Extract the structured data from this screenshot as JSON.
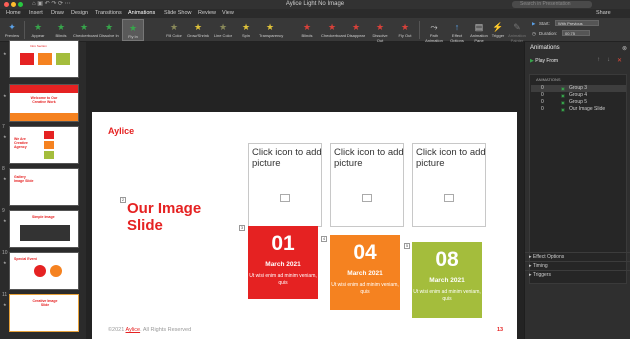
{
  "window": {
    "title": "Aylice Light No Image",
    "search_placeholder": "Search in Presentation"
  },
  "colors": {
    "close": "#fe5f57",
    "minimize": "#febc2e",
    "maximize": "#28c840",
    "accent": "#e52222"
  },
  "tabs": [
    "Home",
    "Insert",
    "Draw",
    "Design",
    "Transitions",
    "Animations",
    "Slide Show",
    "Review",
    "View"
  ],
  "share_label": "Share",
  "ribbon": {
    "preview": "Preview",
    "effects": [
      {
        "label": "Appear",
        "icon": "star-icon",
        "color": "#37a64b"
      },
      {
        "label": "Blinds",
        "icon": "star-icon",
        "color": "#37a64b"
      },
      {
        "label": "Checkerboard",
        "icon": "star-icon",
        "color": "#37a64b"
      },
      {
        "label": "Dissolve In",
        "icon": "star-icon",
        "color": "#37a64b"
      },
      {
        "label": "Fly In",
        "icon": "star-icon",
        "color": "#37a64b"
      },
      {
        "label": "Fill Color",
        "icon": "star-icon",
        "color": "#8a8a5a"
      },
      {
        "label": "Grow/Shrink",
        "icon": "star-icon",
        "color": "#e0c33a"
      },
      {
        "label": "Line Color",
        "icon": "star-icon",
        "color": "#8a8a5a"
      },
      {
        "label": "Spin",
        "icon": "star-icon",
        "color": "#e0c33a"
      },
      {
        "label": "Transparency",
        "icon": "star-icon",
        "color": "#e0c33a"
      },
      {
        "label": "Blinds",
        "icon": "star-icon",
        "color": "#d9413a"
      },
      {
        "label": "Checkerboard",
        "icon": "star-icon",
        "color": "#d9413a"
      },
      {
        "label": "Disappear",
        "icon": "star-icon",
        "color": "#d9413a"
      },
      {
        "label": "Dissolve Out",
        "icon": "star-icon",
        "color": "#d9413a"
      },
      {
        "label": "Fly Out",
        "icon": "star-icon",
        "color": "#d9413a"
      }
    ],
    "path_animation": "Path Animation",
    "effect_options": "Effect Options",
    "animation_pane": "Animation Pane",
    "trigger": "Trigger",
    "animation_painter": "Animation Painter",
    "start_label": "Start:",
    "start_value": "With Previous",
    "duration_label": "Duration:",
    "duration_value": "00.75"
  },
  "thumbnails": [
    {
      "number": "",
      "star": "★"
    },
    {
      "number": "",
      "star": "★"
    },
    {
      "number": "7",
      "star": "★"
    },
    {
      "number": "8",
      "star": "★"
    },
    {
      "number": "9",
      "star": "★"
    },
    {
      "number": "10",
      "star": "★"
    },
    {
      "number": "11",
      "star": "★"
    }
  ],
  "slide": {
    "brand": "Aylice",
    "heading": "Our Image Slide",
    "tags": [
      "2",
      "3",
      "4",
      "5"
    ],
    "cards": [
      {
        "placeholder": "Click icon to add picture",
        "number": "01",
        "date": "March 2021",
        "desc": "Ut wisi enim ad minim veniam, quis",
        "color": "#e52222"
      },
      {
        "placeholder": "Click icon to add picture",
        "number": "04",
        "date": "March 2021",
        "desc": "Ut wisi enim ad minim veniam, quis",
        "color": "#f58220"
      },
      {
        "placeholder": "Click icon to add picture",
        "number": "08",
        "date": "March 2021",
        "desc": "Ut wisi enim ad minim veniam, quis",
        "color": "#a4bd3c"
      }
    ],
    "footer_prefix": "©2021 ",
    "footer_brand": "Aylice",
    "footer_suffix": ". All Rights Reserved",
    "page_number": "13"
  },
  "animations_pane": {
    "title": "Animations",
    "play_from": "Play From",
    "list_header": "ANIMATIONS",
    "items": [
      {
        "num": "0",
        "label": "Group 3",
        "selected": true
      },
      {
        "num": "0",
        "label": "Group 4",
        "selected": false
      },
      {
        "num": "0",
        "label": "Group 5",
        "selected": false
      },
      {
        "num": "0",
        "label": "Our Image Slide",
        "selected": false
      }
    ],
    "sections": [
      "Effect Options",
      "Timing",
      "Triggers"
    ]
  }
}
